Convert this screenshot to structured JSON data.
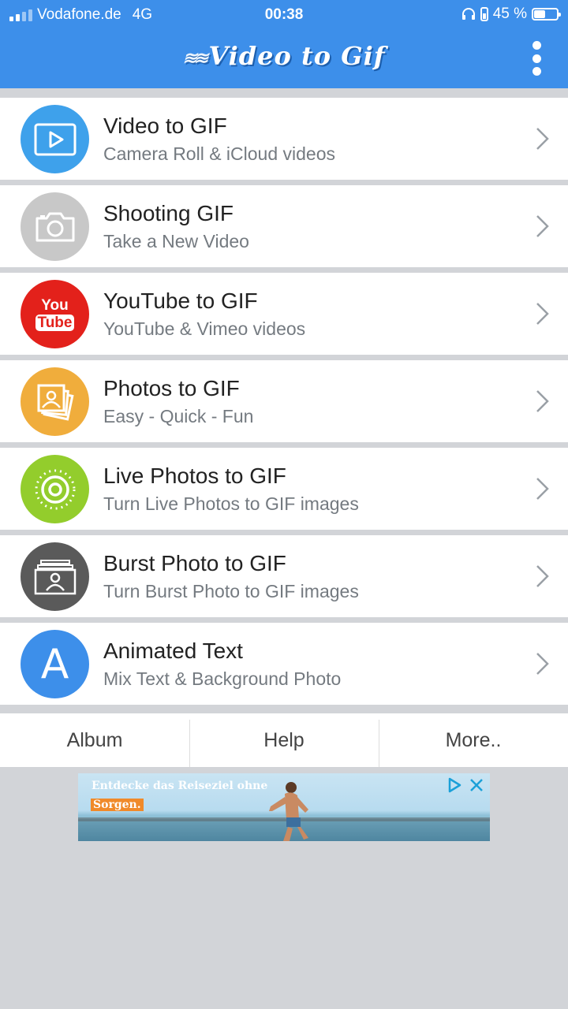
{
  "status_bar": {
    "carrier": "Vodafone.de",
    "network": "4G",
    "time": "00:38",
    "battery": "45 %"
  },
  "header": {
    "title": "Video to Gif",
    "menu_icon": "more-vertical-icon",
    "background": "#3d8fea"
  },
  "items": [
    {
      "title": "Video to GIF",
      "subtitle": "Camera Roll & iCloud videos",
      "icon": "video-play-icon",
      "color": "#3ea1eb"
    },
    {
      "title": "Shooting GIF",
      "subtitle": "Take a New Video",
      "icon": "camera-icon",
      "color": "#c8c8c8"
    },
    {
      "title": "YouTube to GIF",
      "subtitle": "YouTube & Vimeo videos",
      "icon": "youtube-icon",
      "color": "#e3211b"
    },
    {
      "title": "Photos to GIF",
      "subtitle": "Easy - Quick - Fun",
      "icon": "photos-stack-icon",
      "color": "#f0ad3c"
    },
    {
      "title": "Live Photos to GIF",
      "subtitle": "Turn Live Photos to GIF images",
      "icon": "live-photo-icon",
      "color": "#93cd2c"
    },
    {
      "title": "Burst Photo to GIF",
      "subtitle": "Turn Burst Photo to GIF images",
      "icon": "burst-photo-icon",
      "color": "#5a5a5a"
    },
    {
      "title": "Animated Text",
      "subtitle": "Mix Text & Background Photo",
      "icon": "letter-a-icon",
      "color": "#3d8fea"
    }
  ],
  "youtube_logo": {
    "top": "You",
    "bottom": "Tube"
  },
  "text_icon_letter": "A",
  "tabs": [
    "Album",
    "Help",
    "More.."
  ],
  "ad": {
    "line1": "Entdecke das Reiseziel ohne",
    "line2": "Sorgen."
  }
}
